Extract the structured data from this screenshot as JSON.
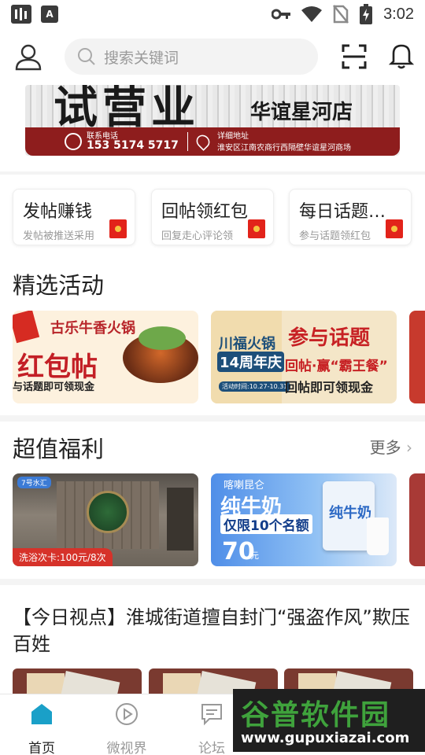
{
  "status_bar": {
    "left_icon_1": "signal-bars-icon",
    "left_icon_2_text": "A",
    "time": "3:02",
    "icons": [
      "key-icon",
      "wifi-icon",
      "no-sim-icon",
      "battery-charging-icon"
    ]
  },
  "header": {
    "avatar_icon": "user-avatar-icon",
    "search_placeholder": "搜索关键词",
    "scan_icon": "scan-icon",
    "bell_icon": "bell-icon"
  },
  "banner": {
    "big_text": "试营业",
    "store_name": "华谊星河店",
    "contact_label": "联系电话",
    "phone": "153 5174 5717",
    "address_label": "详细地址",
    "address": "淮安区江南农商行西隔壁华谊星河商场"
  },
  "tasks": [
    {
      "title": "发帖赚钱",
      "subtitle": "发帖被推送采用"
    },
    {
      "title": "回帖领红包",
      "subtitle": "回复走心评论领"
    },
    {
      "title": "每日话题…",
      "subtitle": "参与话题领红包"
    }
  ],
  "activities": {
    "title": "精选活动",
    "items": [
      {
        "title": "古乐牛香火锅",
        "big": "红包帖",
        "subtitle": "与话题即可领现金"
      },
      {
        "brand": "川福火锅",
        "anniversary": "14周年庆",
        "date": "活动时间:10.27-10.31",
        "title": "参与话题",
        "subtitle": "回帖·赢“霸王餐”",
        "subtitle2": "回帖即可领现金"
      }
    ]
  },
  "welfare": {
    "title": "超值福利",
    "more_label": "更多",
    "items": [
      {
        "tag": "7号水汇",
        "label": "洗浴次卡:100元/8次"
      },
      {
        "brand": "喀喇昆仑",
        "title": "纯牛奶",
        "subtitle": "仅限10个名额",
        "price": "70",
        "unit": "元",
        "pack_text": "纯牛奶"
      }
    ]
  },
  "news": {
    "title": "【今日视点】淮城街道擅自封门“强盗作风”欺压百姓"
  },
  "bottom_nav": [
    {
      "label": "首页",
      "icon": "home-icon",
      "active": true
    },
    {
      "label": "微视界",
      "icon": "play-circle-icon",
      "active": false
    },
    {
      "label": "论坛",
      "icon": "chat-icon",
      "active": false
    }
  ],
  "watermark": {
    "title": "谷普软件园",
    "url": "www.gupuxiazai.com"
  },
  "colors": {
    "accent": "#1aa0c8",
    "red": "#c32026",
    "text": "#222222",
    "muted": "#999999"
  }
}
